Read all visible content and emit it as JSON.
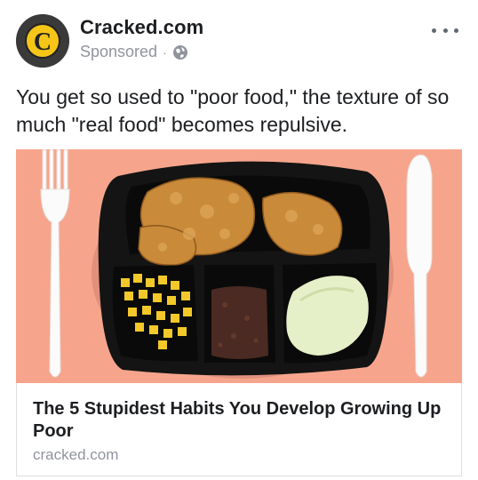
{
  "post": {
    "page_name": "Cracked.com",
    "avatar_letter": "C",
    "sponsored_label": "Sponsored",
    "separator": "·",
    "privacy_icon": "globe-icon",
    "more_icon": "more-options-icon",
    "text": "You get so used to \"poor food,\" the texture of so much \"real food\" becomes repulsive."
  },
  "link_card": {
    "image": "tv-dinner-tray-photo",
    "title": "The 5 Stupidest Habits You Develop Growing Up Poor",
    "domain": "cracked.com"
  },
  "colors": {
    "avatar_bg": "#3a3a3a",
    "avatar_letter": "#f5c518",
    "secondary_text": "#90949c",
    "image_background": "#f6a58c"
  }
}
